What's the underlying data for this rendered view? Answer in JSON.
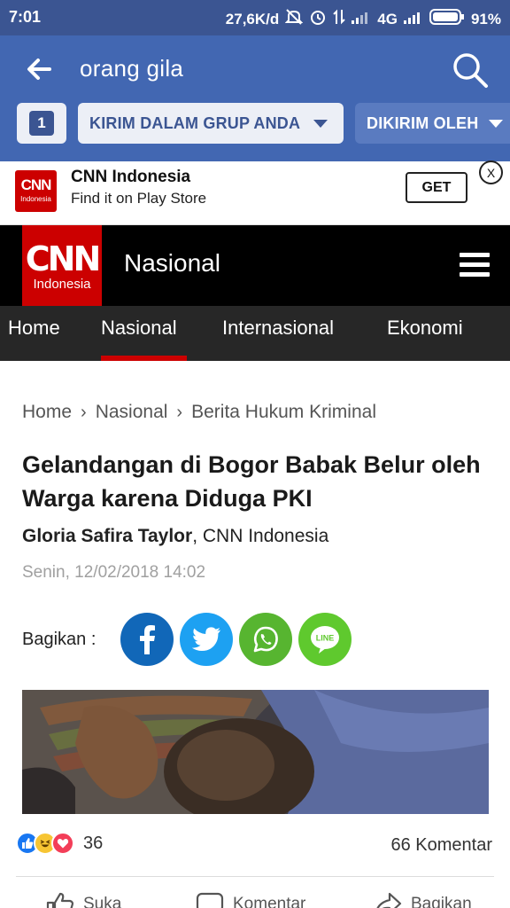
{
  "status_bar": {
    "time": "7:01",
    "speed": "27,6K/d",
    "network": "4G",
    "battery": "91%"
  },
  "search": {
    "query": "orang gila",
    "filter_count": "1",
    "filter_group": "KIRIM DALAM GRUP ANDA",
    "filter_sent": "DIKIRIM OLEH"
  },
  "banner": {
    "logo_line1": "CNN",
    "logo_line2": "Indonesia",
    "app_name": "CNN Indonesia",
    "subtitle": "Find it on Play Store",
    "get_label": "GET",
    "close_label": "X"
  },
  "cnn": {
    "logo_line1": "CNN",
    "logo_line2": "Indonesia",
    "section": "Nasional",
    "nav": [
      "Home",
      "Nasional",
      "Internasional",
      "Ekonomi"
    ],
    "active_nav": "Nasional"
  },
  "article": {
    "breadcrumb": [
      "Home",
      "Nasional",
      "Berita Hukum Kriminal"
    ],
    "breadcrumb_sep": "›",
    "headline": "Gelandangan di Bogor Babak Belur oleh Warga karena Diduga PKI",
    "author": "Gloria Safira Taylor",
    "outlet": ", CNN Indonesia",
    "date": "Senin, 12/02/2018 14:02",
    "share_label": "Bagikan :",
    "line_label": "LINE"
  },
  "facebook": {
    "reaction_count": "36",
    "comments": "66 Komentar",
    "like": "Suka",
    "comment": "Komentar",
    "share": "Bagikan"
  },
  "colors": {
    "fb_blue": "#4267b2",
    "cnn_red": "#cc0000",
    "facebook_share": "#1167b8",
    "twitter": "#1da1f2",
    "whatsapp": "#57b530",
    "line": "#5fc92e"
  }
}
